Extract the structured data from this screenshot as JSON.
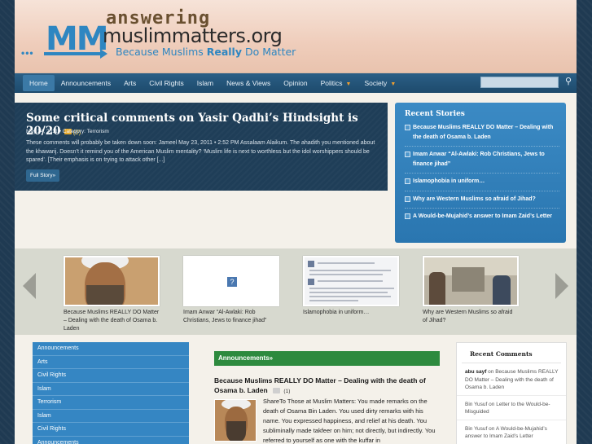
{
  "site": {
    "logo_mm": "MM",
    "logo_word1": "answering",
    "logo_word2": "muslimmatters.org",
    "tagline_a": "Because Muslims ",
    "tagline_b": "Really",
    "tagline_c": " Do Matter"
  },
  "nav": {
    "items": [
      {
        "label": "Home",
        "active": true
      },
      {
        "label": "Announcements"
      },
      {
        "label": "Arts"
      },
      {
        "label": "Civil Rights"
      },
      {
        "label": "Islam"
      },
      {
        "label": "News & Views"
      },
      {
        "label": "Opinion"
      },
      {
        "label": "Politics",
        "dropdown": true
      },
      {
        "label": "Society",
        "dropdown": true
      }
    ],
    "search_placeholder": ""
  },
  "featured": {
    "title": "Some critical comments on Yasir Qadhi’s Hindsight is 20/20",
    "comment_count": "(0)",
    "date": "May 24, 2011",
    "category_label": "• Category:",
    "category": "Terrorism",
    "excerpt": "These comments will probably be taken down soon:   Jameel May 23, 2011 • 2:52 PM Assalaam Alaikum. The ahadith you mentioned about the khawarij. Doesn’t it remind you of the American Muslim mentality? ‘Muslim life is next to worthless but the idol worshippers should be spared’. [Their emphasis is on trying to attack other [...]",
    "button": "Full Story»"
  },
  "recent_stories": {
    "title": "Recent Stories",
    "items": [
      "Because Muslims REALLY DO Matter – Dealing with the death of Osama b. Laden",
      "Imam Anwar “Al-Awlaki: Rob Christians, Jews to finance jihad”",
      "Islamophobia in uniform…",
      "Why are Western Muslims so afraid of Jihad?",
      "A Would-be-Mujahid’s answer to Imam Zaid’s Letter"
    ]
  },
  "carousel": {
    "slides": [
      "Because Muslims REALLY DO Matter – Dealing with the death of Osama b. Laden",
      "Imam Anwar “Al-Awlaki: Rob Christians, Jews to finance jihad”",
      "Islamophobia in uniform…",
      "Why are Western Muslims so afraid of Jihad?"
    ]
  },
  "categories": [
    "Announcements",
    "Arts",
    "Civil Rights",
    "Islam",
    "Terrorism",
    "Islam",
    "Civil Rights",
    "Announcements"
  ],
  "announcements": {
    "header": "Announcements»",
    "post_title": "Because Muslims REALLY DO Matter – Dealing with the death of Osama b. Laden",
    "post_count": "(1)",
    "excerpt": "ShareTo Those at Muslim Matters:  You made remarks on the death of Osama Bin Laden. You used dirty remarks with his name. You expressed happiness, and relief at his death. You subliminally made takfeer on him; not directly, but indirectly. You referred to yourself as one with the kuffar in"
  },
  "recent_comments": {
    "title": "Recent Comments",
    "items": [
      {
        "author": "abu sayf",
        "on": " on ",
        "post": "Because Muslims REALLY DO Matter – Dealing with the death of Osama b. Laden"
      },
      {
        "author": "Bin Yusuf",
        "on": " on ",
        "post": "Letter to the Would-be-Misguided"
      },
      {
        "author": "Bin Yusuf",
        "on": " on ",
        "post": "A Would-be-Mujahid’s answer to Imam Zaid’s Letter"
      }
    ]
  },
  "colors": {
    "nav": "#1d4a6c",
    "accent_blue": "#2e86c1",
    "announcements_green": "#2d8a3e",
    "comment_badge": "#e6a92c"
  }
}
